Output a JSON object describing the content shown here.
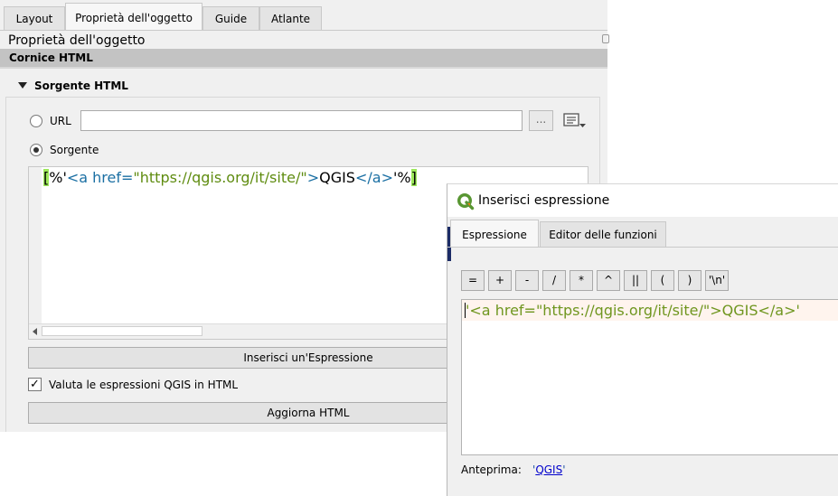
{
  "tabs": [
    {
      "label": "Layout"
    },
    {
      "label": "Proprietà dell'oggetto"
    },
    {
      "label": "Guide"
    },
    {
      "label": "Atlante"
    }
  ],
  "panel": {
    "title": "Proprietà dell'oggetto",
    "section_header": "Cornice HTML",
    "group_title": "Sorgente HTML"
  },
  "source": {
    "url_label": "URL",
    "url_value": "",
    "browse_label": "...",
    "source_label": "Sorgente",
    "code": {
      "open_bracket": "[",
      "pct1": "%'",
      "tag_open": "<a href=",
      "href": "\"https://qgis.org/it/site/\"",
      "tag_close_gt": ">",
      "text": "QGIS",
      "end_tag": "</a>",
      "pct2": "'%",
      "close_bracket": "]"
    }
  },
  "buttons": {
    "insert_expression": "Inserisci un'Espressione",
    "update_html": "Aggiorna HTML"
  },
  "evaluate": {
    "label": "Valuta le espressioni QGIS in HTML",
    "checked": true,
    "check_glyph": "✓"
  },
  "dialog": {
    "title": "Inserisci espressione",
    "tabs": [
      {
        "label": "Espressione"
      },
      {
        "label": "Editor delle funzioni"
      }
    ],
    "operators": [
      "=",
      "+",
      "-",
      "/",
      "*",
      "^",
      "||",
      "(",
      ")",
      "'\\n'"
    ],
    "expression": "'<a href=\"https://qgis.org/it/site/\">QGIS</a>'",
    "preview_label": "Anteprima:",
    "preview_quote_open": "'",
    "preview_link": "QGIS",
    "preview_quote_close": "'"
  },
  "icons": {
    "collapse": "triangle-down-icon",
    "data_defined": "data-defined-override-icon",
    "app": "qgis-logo-icon"
  },
  "colors": {
    "bracket_match": "#9de85a",
    "tag": "#1a6fa3",
    "string": "#5f8c10",
    "expression": "#6f961f",
    "qgis_green": "#589632"
  }
}
